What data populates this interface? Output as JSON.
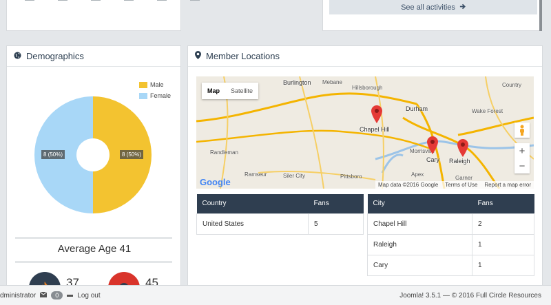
{
  "activities": {
    "see_all_label": "See all activities"
  },
  "demographics": {
    "title": "Demographics",
    "legend": [
      {
        "label": "Male",
        "color": "#f3c330"
      },
      {
        "label": "Female",
        "color": "#a8d7f7"
      }
    ],
    "male_label": "8 (50%)",
    "female_label": "8 (50%)",
    "average_age_label": "Average Age 41",
    "stat_one": "37",
    "stat_two": "45"
  },
  "chart_data": {
    "type": "pie",
    "categories": [
      "Male",
      "Female"
    ],
    "values": [
      8,
      8
    ],
    "colors": [
      "#f3c330",
      "#a8d7f7"
    ],
    "legend": "top-right"
  },
  "member_locations": {
    "title": "Member Locations",
    "map": {
      "type_map": "Map",
      "type_satellite": "Satellite",
      "footer": [
        "Map data ©2016 Google",
        "Terms of Use",
        "Report a map error"
      ],
      "logo": "Google",
      "places": {
        "burlington": "Burlington",
        "mebane": "Mebane",
        "hillsborough": "Hillsborough",
        "durham": "Durham",
        "country": "Country",
        "chapel_hill": "Chapel Hill",
        "wake_forest": "Wake Forest",
        "randleman": "Randleman",
        "morrisville": "Morrisville",
        "cary": "Cary",
        "raleigh": "Raleigh",
        "ramseur": "Ramseur",
        "siler_city": "Siler City",
        "pittsboro": "Pittsboro",
        "apex": "Apex",
        "garner": "Garner"
      }
    },
    "country_table": {
      "headers": [
        "Country",
        "Fans"
      ],
      "rows": [
        [
          "United States",
          "5"
        ]
      ]
    },
    "city_table": {
      "headers": [
        "City",
        "Fans"
      ],
      "rows": [
        [
          "Chapel Hill",
          "2"
        ],
        [
          "Raleigh",
          "1"
        ],
        [
          "Cary",
          "1"
        ]
      ]
    }
  },
  "statusbar": {
    "user": "dministrator",
    "messages_count": "0",
    "logout": "Log out",
    "version": "Joomla! 3.5.1",
    "copyright": "— © 2016 Full Circle Resources"
  }
}
